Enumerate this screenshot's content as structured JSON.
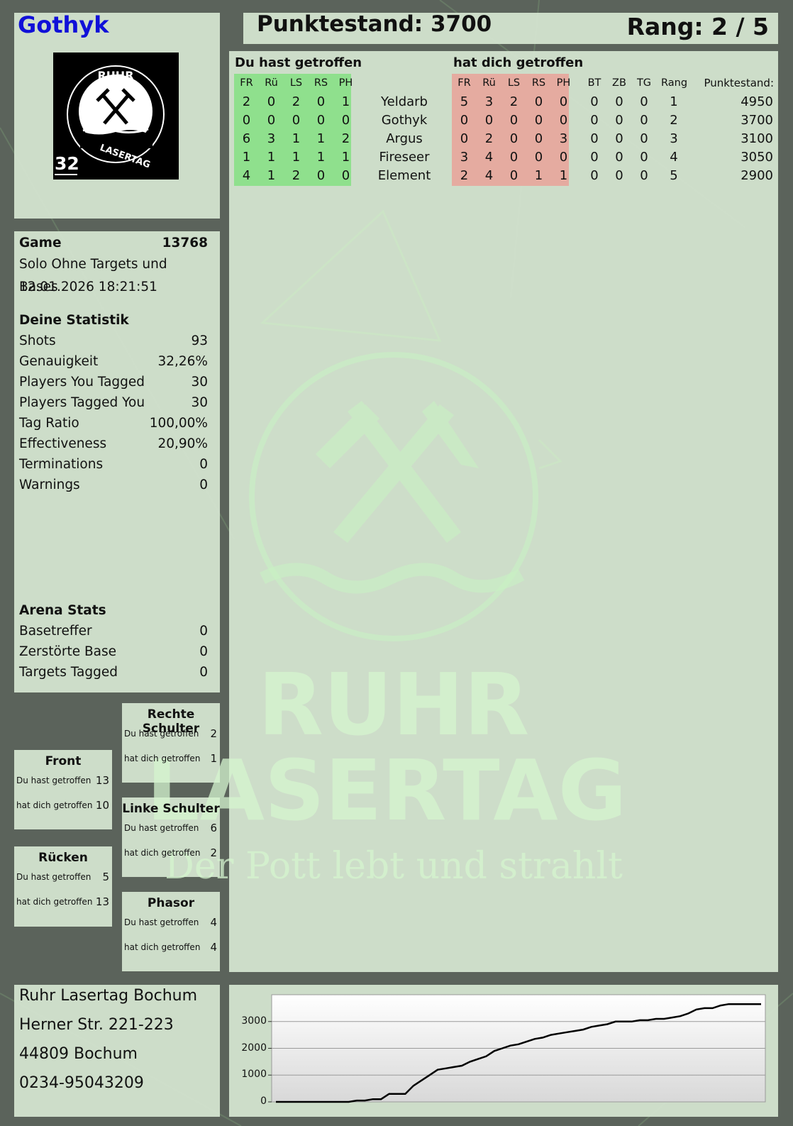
{
  "header": {
    "player_name": "Gothyk",
    "score_label": "Punktestand: 3700",
    "rank_label": "Rang: 2 / 5"
  },
  "logo": {
    "ring_text": "RUHR",
    "ring_text_bottom": "LASERTAG",
    "badge_number": "32"
  },
  "game": {
    "label": "Game",
    "number": "13768",
    "mode": "Solo Ohne Targets und Bases",
    "datetime": "12.01.2026 18:21:51"
  },
  "statistics": {
    "heading": "Deine Statistik",
    "rows": [
      {
        "label": "Shots",
        "value": "93"
      },
      {
        "label": "Genauigkeit",
        "value": "32,26%"
      },
      {
        "label": "Players You Tagged",
        "value": "30"
      },
      {
        "label": "Players Tagged You",
        "value": "30"
      },
      {
        "label": "Tag Ratio",
        "value": "100,00%"
      },
      {
        "label": "Effectiveness",
        "value": "20,90%"
      },
      {
        "label": "Terminations",
        "value": "0"
      },
      {
        "label": "Warnings",
        "value": "0"
      }
    ]
  },
  "arena": {
    "heading": "Arena Stats",
    "rows": [
      {
        "label": "Basetreffer",
        "value": "0"
      },
      {
        "label": "Zerstörte Base",
        "value": "0"
      },
      {
        "label": "Targets Tagged",
        "value": "0"
      }
    ]
  },
  "table": {
    "hit_title": "Du hast getroffen",
    "got_hit_title": "hat dich getroffen",
    "zone_headers": [
      "FR",
      "Rü",
      "LS",
      "RS",
      "PH"
    ],
    "extra_headers": [
      "BT",
      "ZB",
      "TG",
      "Rang"
    ],
    "points_header": "Punktestand:",
    "players": [
      {
        "name": "Yeldarb",
        "hit": [
          "2",
          "0",
          "2",
          "0",
          "1"
        ],
        "got": [
          "5",
          "3",
          "2",
          "0",
          "0"
        ],
        "extra": [
          "0",
          "0",
          "0",
          "1"
        ],
        "points": "4950"
      },
      {
        "name": "Gothyk",
        "hit": [
          "0",
          "0",
          "0",
          "0",
          "0"
        ],
        "got": [
          "0",
          "0",
          "0",
          "0",
          "0"
        ],
        "extra": [
          "0",
          "0",
          "0",
          "2"
        ],
        "points": "3700"
      },
      {
        "name": "Argus",
        "hit": [
          "6",
          "3",
          "1",
          "1",
          "2"
        ],
        "got": [
          "0",
          "2",
          "0",
          "0",
          "3"
        ],
        "extra": [
          "0",
          "0",
          "0",
          "3"
        ],
        "points": "3100"
      },
      {
        "name": "Fireseer",
        "hit": [
          "1",
          "1",
          "1",
          "1",
          "1"
        ],
        "got": [
          "3",
          "4",
          "0",
          "0",
          "0"
        ],
        "extra": [
          "0",
          "0",
          "0",
          "4"
        ],
        "points": "3050"
      },
      {
        "name": "Element",
        "hit": [
          "4",
          "1",
          "2",
          "0",
          "0"
        ],
        "got": [
          "2",
          "4",
          "0",
          "1",
          "1"
        ],
        "extra": [
          "0",
          "0",
          "0",
          "5"
        ],
        "points": "2900"
      }
    ]
  },
  "zones": {
    "hit_label": "Du hast getroffen",
    "got_label": "hat dich getroffen",
    "items": [
      {
        "title": "Rechte Schulter",
        "hit": "2",
        "got": "1"
      },
      {
        "title": "Front",
        "hit": "13",
        "got": "10"
      },
      {
        "title": "Linke Schulter",
        "hit": "6",
        "got": "2"
      },
      {
        "title": "Rücken",
        "hit": "5",
        "got": "13"
      },
      {
        "title": "Phasor",
        "hit": "4",
        "got": "4"
      }
    ]
  },
  "address": {
    "lines": [
      "Ruhr Lasertag Bochum",
      "Herner Str. 221-223",
      "44809 Bochum",
      "0234-95043209"
    ]
  },
  "watermark": {
    "line1": "RUHR",
    "line2": "LASERTAG",
    "slogan": "Der Pott lebt und strahlt"
  },
  "colors": {
    "player_name": "#1010d8",
    "hit_bg": "#8fe08d",
    "got_hit_bg": "#e5aba0",
    "panel": "#d6e6d2"
  },
  "chart_data": {
    "type": "line",
    "title": "",
    "xlabel": "",
    "ylabel": "",
    "ylim": [
      0,
      4000
    ],
    "yticks": [
      "0",
      "1000",
      "2000",
      "3000"
    ],
    "x": [
      0,
      1,
      2,
      3,
      4,
      5,
      6,
      7,
      8,
      9,
      10,
      11,
      12,
      13,
      14,
      15,
      16,
      17,
      18,
      19,
      20,
      21,
      22,
      23,
      24,
      25,
      26,
      27,
      28,
      29,
      30,
      31,
      32,
      33,
      34,
      35,
      36,
      37,
      38,
      39,
      40,
      41,
      42,
      43,
      44,
      45,
      46,
      47,
      48,
      49,
      50,
      51,
      52,
      53,
      54,
      55,
      56,
      57,
      58,
      59,
      60
    ],
    "series": [
      {
        "values": [
          0,
          0,
          0,
          0,
          0,
          0,
          0,
          0,
          0,
          0,
          50,
          50,
          100,
          100,
          300,
          300,
          300,
          600,
          800,
          1000,
          1200,
          1250,
          1300,
          1350,
          1500,
          1600,
          1700,
          1900,
          2000,
          2100,
          2150,
          2250,
          2350,
          2400,
          2500,
          2550,
          2600,
          2650,
          2700,
          2800,
          2850,
          2900,
          3000,
          3000,
          3000,
          3050,
          3050,
          3100,
          3100,
          3150,
          3200,
          3300,
          3450,
          3500,
          3500,
          3600,
          3650,
          3650,
          3650,
          3650,
          3650
        ]
      }
    ]
  }
}
